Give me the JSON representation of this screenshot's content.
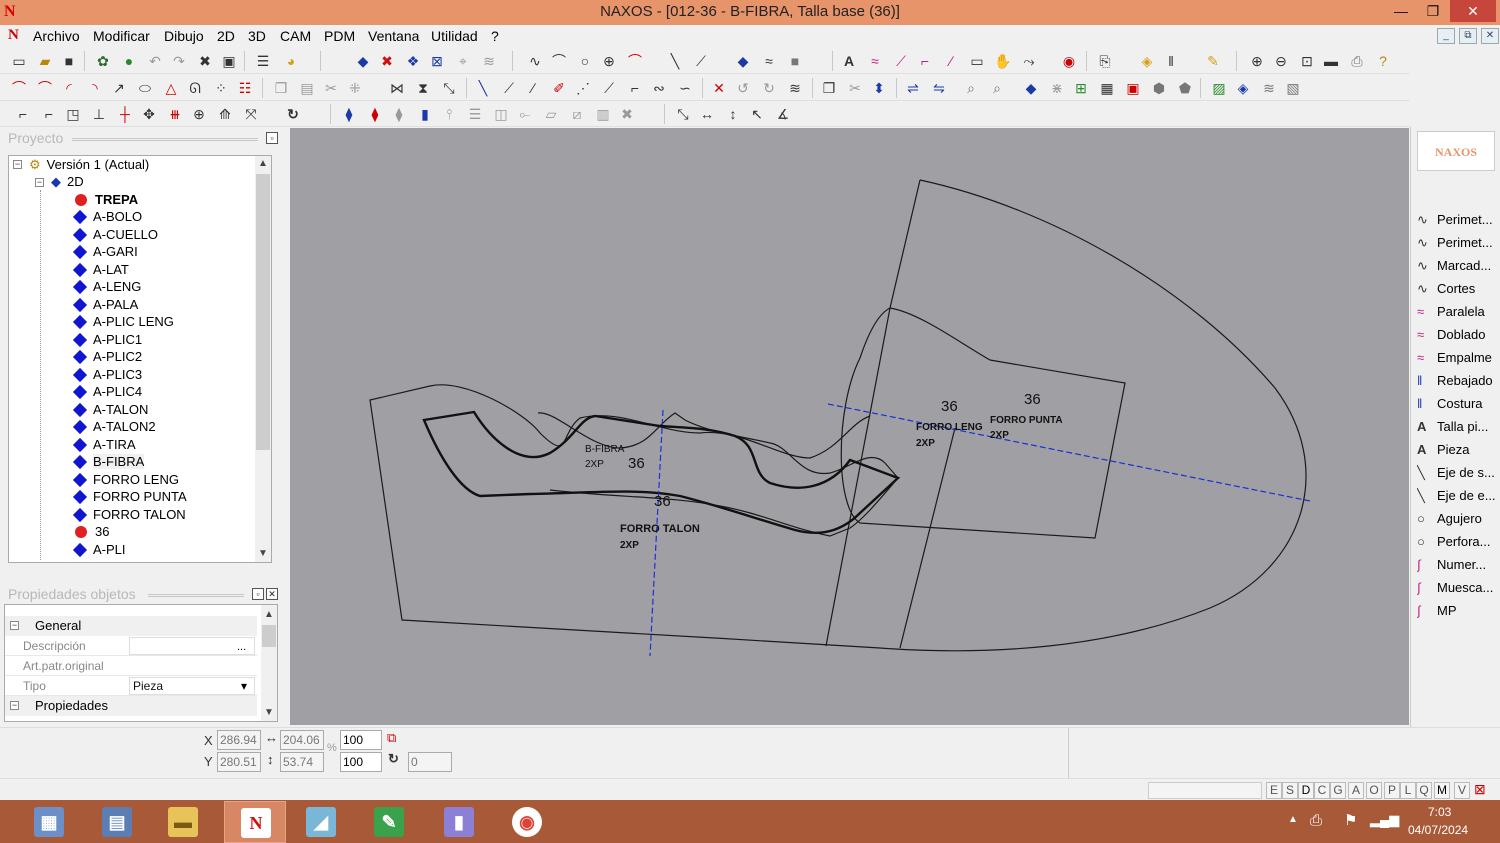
{
  "window": {
    "title": "NAXOS - [012-36 - B-FIBRA, Talla base (36)]",
    "logo_glyph": "N",
    "controls": {
      "minimize": "—",
      "maximize": "❐",
      "close": "✕"
    }
  },
  "menu": {
    "items": [
      "Archivo",
      "Modificar",
      "Dibujo",
      "2D",
      "3D",
      "CAM",
      "PDM",
      "Ventana",
      "Utilidad",
      "?"
    ],
    "mdi": [
      "_",
      "⧉",
      "✕"
    ]
  },
  "project_panel": {
    "title": "Proyecto",
    "root": "Versión 1 (Actual)",
    "folder": "2D",
    "items": [
      {
        "label": "TREPA",
        "marker": "dot",
        "bold": true
      },
      {
        "label": "A-BOLO",
        "marker": "diamond"
      },
      {
        "label": "A-CUELLO",
        "marker": "diamond"
      },
      {
        "label": "A-GARI",
        "marker": "diamond"
      },
      {
        "label": "A-LAT",
        "marker": "diamond"
      },
      {
        "label": "A-LENG",
        "marker": "diamond"
      },
      {
        "label": "A-PALA",
        "marker": "diamond"
      },
      {
        "label": "A-PLIC LENG",
        "marker": "diamond"
      },
      {
        "label": "A-PLIC1",
        "marker": "diamond"
      },
      {
        "label": "A-PLIC2",
        "marker": "diamond"
      },
      {
        "label": "A-PLIC3",
        "marker": "diamond"
      },
      {
        "label": "A-PLIC4",
        "marker": "diamond"
      },
      {
        "label": "A-TALON",
        "marker": "diamond"
      },
      {
        "label": "A-TALON2",
        "marker": "diamond"
      },
      {
        "label": "A-TIRA",
        "marker": "diamond"
      },
      {
        "label": "B-FIBRA",
        "marker": "diamond",
        "selected": true
      },
      {
        "label": "FORRO LENG",
        "marker": "diamond"
      },
      {
        "label": "FORRO PUNTA",
        "marker": "diamond"
      },
      {
        "label": "FORRO TALON",
        "marker": "diamond"
      },
      {
        "label": "36",
        "marker": "dot"
      },
      {
        "label": "A-PLI",
        "marker": "diamond"
      }
    ]
  },
  "properties_panel": {
    "title": "Propiedades objetos",
    "group_general": "General",
    "rows": [
      {
        "key": "Descripción",
        "value": "",
        "button": "..."
      },
      {
        "key": "Art.patr.original",
        "value": ""
      },
      {
        "key": "Tipo",
        "value": "Pieza",
        "dropdown": "▾"
      }
    ],
    "group_props": "Propiedades"
  },
  "canvas": {
    "labels": {
      "bfibra_name": "B-FIBRA",
      "bfibra_qty": "2XP",
      "bfibra_size": "36",
      "talon_size": "36",
      "talon_name": "FORRO TALON",
      "talon_qty": "2XP",
      "leng_size": "36",
      "leng_name": "FORRO LENG",
      "leng_qty": "2XP",
      "punta_size": "36",
      "punta_name": "FORRO PUNTA",
      "punta_qty": "2XP"
    },
    "colors": {
      "background": "#a0a0a4",
      "outline": "#1a1a1a",
      "axis": "#1a2fd6"
    }
  },
  "right_tools": {
    "logo": "NAXOS",
    "items": [
      {
        "label": "Perimet...",
        "icon": "curve"
      },
      {
        "label": "Perimet...",
        "icon": "curve"
      },
      {
        "label": "Marcad...",
        "icon": "curve"
      },
      {
        "label": "Cortes",
        "icon": "curve"
      },
      {
        "label": "Paralela",
        "icon": "double-curve"
      },
      {
        "label": "Doblado",
        "icon": "double-curve"
      },
      {
        "label": "Empalme",
        "icon": "double-curve"
      },
      {
        "label": "Rebajado",
        "icon": "stitch"
      },
      {
        "label": "Costura",
        "icon": "stitch"
      },
      {
        "label": "Talla pi...",
        "icon": "text"
      },
      {
        "label": "Pieza",
        "icon": "text"
      },
      {
        "label": "Eje de s...",
        "icon": "axis"
      },
      {
        "label": "Eje de e...",
        "icon": "axis"
      },
      {
        "label": "Agujero",
        "icon": "circle"
      },
      {
        "label": "Perfora...",
        "icon": "circle"
      },
      {
        "label": "Numer...",
        "icon": "pen"
      },
      {
        "label": "Muesca...",
        "icon": "pen"
      },
      {
        "label": "MP",
        "icon": "pen"
      }
    ]
  },
  "coords": {
    "x_label": "X",
    "y_label": "Y",
    "x": "286.94",
    "y": "280.51",
    "width": "204.06",
    "height": "53.74",
    "scale_x": "100",
    "scale_y": "100",
    "rotation": "0",
    "percent_sign": "%"
  },
  "status_letters": [
    "E",
    "S",
    "D",
    "C",
    "G",
    "A",
    "O",
    "P",
    "L",
    "Q",
    "M",
    "V"
  ],
  "taskbar": {
    "apps": [
      "calculator",
      "explorer-docs",
      "file-explorer",
      "naxos",
      "notes",
      "greenshot",
      "tasks",
      "chrome"
    ],
    "time": "7:03",
    "date": "04/07/2024"
  }
}
